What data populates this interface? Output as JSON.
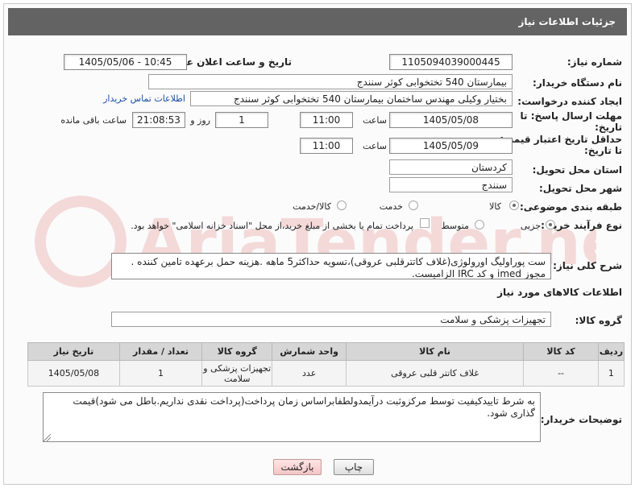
{
  "header": {
    "title": "جزئیات اطلاعات نیاز"
  },
  "need_number": {
    "label": "شماره نیاز:",
    "value": "1105094039000445"
  },
  "announce": {
    "label": "تاریخ و ساعت اعلان عمومی:",
    "value": "1405/05/06 - 10:45"
  },
  "buyer_org": {
    "label": "نام دستگاه خریدار:",
    "value": "بیمارستان 540 تختخوابی کوثر سنندج"
  },
  "requester": {
    "label": "ایجاد کننده درخواست:",
    "value": "بختیار وکیلی مهندس ساختمان بیمارستان 540 تختخوابی کوثر سنندج",
    "contact_link": "اطلاعات تماس خریدار"
  },
  "deadline": {
    "label_line1": "مهلت ارسال پاسخ: تا",
    "label_line2": "تاریخ:",
    "date": "1405/05/08",
    "time_label": "ساعت",
    "time": "11:00",
    "days": "1",
    "days_label": "روز و",
    "remaining": "21:08:53",
    "remaining_label": "ساعت باقی مانده"
  },
  "price_validity": {
    "label_line1": "حداقل تاریخ اعتبار قیمت:",
    "label_line2": "تا تاریخ:",
    "date": "1405/05/09",
    "time_label": "ساعت",
    "time": "11:00"
  },
  "province": {
    "label": "استان محل تحویل:",
    "value": "کردستان"
  },
  "city": {
    "label": "شهر محل تحویل:",
    "value": "سنندج"
  },
  "category": {
    "label": "طبقه بندی موضوعی:",
    "options": [
      "کالا",
      "خدمت",
      "کالا/خدمت"
    ],
    "selected": "کالا"
  },
  "process": {
    "label": "نوع فرآیند خرید :",
    "options": [
      "جزیی",
      "متوسط"
    ],
    "selected": "جزیی",
    "payment_note": "پرداخت تمام یا بخشی از مبلغ خرید،از محل \"اسناد خزانه اسلامی\" خواهد بود."
  },
  "summary": {
    "label": "شرح کلی نیاز:",
    "text": "ست پوراولیگ اورولوژی(غلاف کاتترقلبی عروقی)،تسویه حداکثر5 ماهه .هزینه حمل برعهده تامین کننده . مجوز imed و کد IRC  الزامیست."
  },
  "goods_info": {
    "title": "اطلاعات کالاهای مورد نیاز"
  },
  "goods_group": {
    "label": "گروه کالا:",
    "value": "تجهیزات پزشکی و سلامت"
  },
  "table": {
    "headers": [
      "ردیف",
      "کد کالا",
      "نام کالا",
      "واحد شمارش",
      "گروه کالا",
      "تعداد / مقدار",
      "تاریخ نیاز"
    ],
    "rows": [
      [
        "1",
        "--",
        "غلاف کاتتر قلبی عروقی",
        "عدد",
        "تجهیزات پزشکی و سلامت",
        "1",
        "1405/05/08"
      ]
    ]
  },
  "buyer_notes": {
    "label": "توضیحات خریدار:",
    "text": "به شرط تاییدکیفیت توسط مرکزوثبت درآیمدولطفابراساس زمان پرداخت(پرداخت نقدی نداریم.باطل می شود)قیمت گذاری شود."
  },
  "buttons": {
    "print": "چاپ",
    "back": "بازگشت"
  },
  "watermark": {
    "text": "AriaTender.net"
  }
}
